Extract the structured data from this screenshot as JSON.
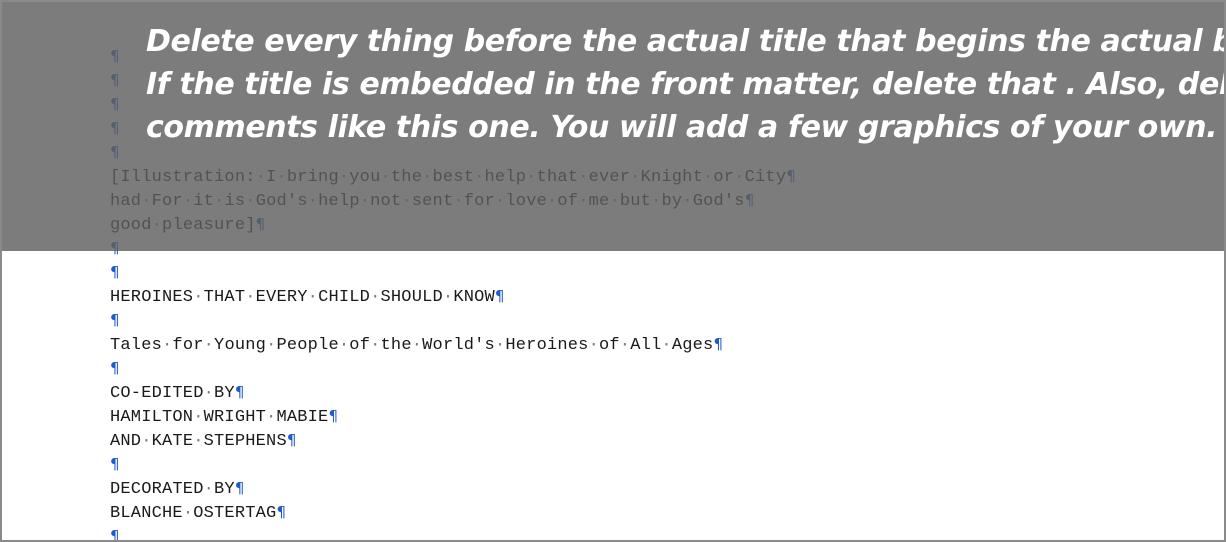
{
  "document": {
    "pilcrow": "¶",
    "space_dot": "·",
    "lines": [
      {
        "text": "",
        "marker": true
      },
      {
        "text": "",
        "marker": true
      },
      {
        "text": "",
        "marker": true
      },
      {
        "text": "",
        "marker": true
      },
      {
        "text": "",
        "marker": true
      },
      {
        "text": "[Illustration: I bring you the best help that ever Knight or City",
        "marker": true
      },
      {
        "text": "had For it is God's help not sent for love of me but by God's",
        "marker": true
      },
      {
        "text": "good pleasure]",
        "marker": true
      },
      {
        "text": "",
        "marker": true
      },
      {
        "text": "",
        "marker": true
      },
      {
        "text": "HEROINES THAT EVERY CHILD SHOULD KNOW",
        "marker": true
      },
      {
        "text": "",
        "marker": true
      },
      {
        "text": "Tales for Young People of the World's Heroines of All Ages",
        "marker": true
      },
      {
        "text": "",
        "marker": true
      },
      {
        "text": "CO-EDITED BY",
        "marker": true
      },
      {
        "text": "HAMILTON WRIGHT MABIE",
        "marker": true
      },
      {
        "text": "AND KATE STEPHENS",
        "marker": true
      },
      {
        "text": "",
        "marker": true
      },
      {
        "text": "DECORATED BY",
        "marker": true
      },
      {
        "text": "BLANCHE OSTERTAG",
        "marker": true
      },
      {
        "text": "",
        "marker": true
      }
    ]
  },
  "instruction": {
    "lines": [
      "Delete every thing before the actual title that begins the actual book.",
      "If the title is embedded in the front matter, delete that . Also, delete",
      "comments like this one. You will add  a few graphics of your own."
    ]
  },
  "colors": {
    "overlay": "#5f5f5f",
    "pilcrow": "#1f5cc7",
    "text": "#1a1a1a",
    "page": "#ffffff"
  }
}
